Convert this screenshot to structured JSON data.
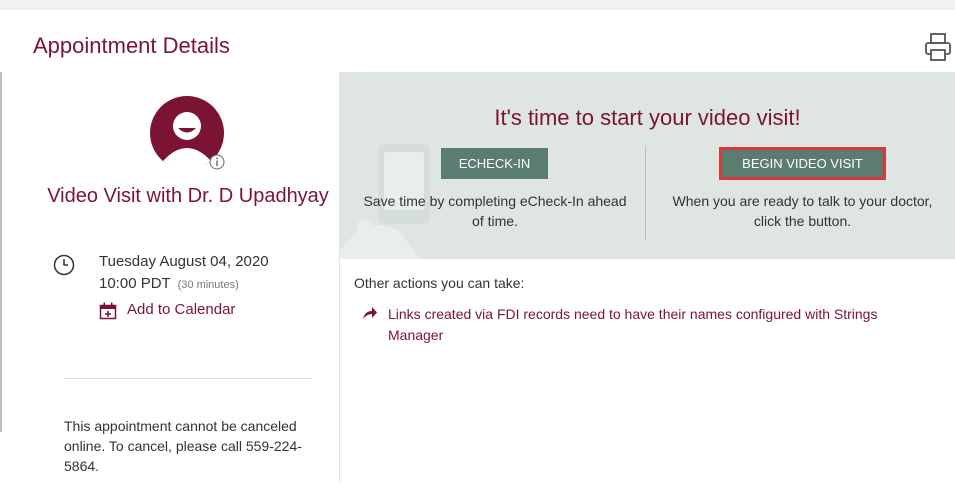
{
  "page": {
    "title": "Appointment Details",
    "print_icon": "printer-icon"
  },
  "visit": {
    "title": "Video Visit with Dr. D Upadhyay",
    "avatar_icon": "doctor-avatar",
    "info_icon": "info-icon",
    "date": "Tuesday August 04, 2020",
    "time": "10:00 PDT",
    "duration": "(30 minutes)",
    "clock_icon": "clock-icon",
    "calendar_icon": "calendar-add-icon",
    "add_to_calendar": "Add to Calendar",
    "cancel_note": "This appointment cannot be canceled online. To cancel, please call 559-224-5864."
  },
  "video_panel": {
    "heading": "It's time to start your video visit!",
    "echeck_label": "ECHECK-IN",
    "echeck_desc": "Save time by completing eCheck-In ahead of time.",
    "begin_label": "BEGIN VIDEO VISIT",
    "begin_desc": "When you are ready to talk to your doctor, click the button."
  },
  "other_actions": {
    "heading": "Other actions you can take:",
    "arrow_icon": "share-arrow-icon",
    "links": [
      "Links created via FDI records need to have their names configured with Strings Manager"
    ]
  },
  "colors": {
    "brand": "#7a1432",
    "button": "#5b7d6f",
    "panel": "#dfe5e1",
    "highlight": "#d63a3a"
  }
}
